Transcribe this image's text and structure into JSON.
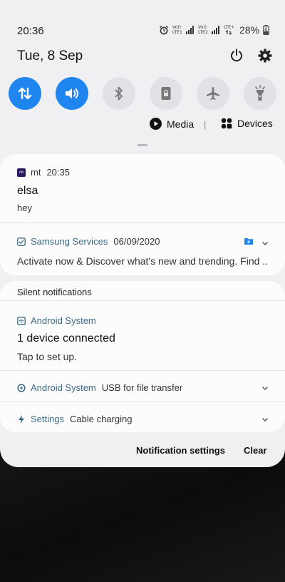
{
  "status_bar": {
    "time": "20:36",
    "sim1_label": "Vo)) LTE1",
    "sim2_label": "Vo)) LTE2",
    "sim2_tag": "LTE+",
    "battery": "28%"
  },
  "header": {
    "date": "Tue, 8 Sep"
  },
  "quick_toggles": [
    {
      "name": "mobile-data",
      "state": "on"
    },
    {
      "name": "sound",
      "state": "on"
    },
    {
      "name": "bluetooth",
      "state": "off"
    },
    {
      "name": "screen-lock",
      "state": "off"
    },
    {
      "name": "airplane-mode",
      "state": "off"
    },
    {
      "name": "flashlight",
      "state": "off"
    }
  ],
  "media_row": {
    "media_label": "Media",
    "separator": "|",
    "devices_label": "Devices"
  },
  "notifications": {
    "mt": {
      "app": "mt",
      "icon_text": "mt",
      "time": "20:35",
      "title": "elsa",
      "body": "hey"
    },
    "samsung": {
      "app": "Samsung Services",
      "date": "06/09/2020",
      "body": "Activate now & Discover what's new and trending. Find .."
    },
    "silent_header": "Silent notifications",
    "android_connected": {
      "app": "Android System",
      "title": "1 device connected",
      "body": "Tap to set up."
    },
    "android_usb": {
      "app": "Android System",
      "text": "USB for file transfer"
    },
    "settings_charging": {
      "app": "Settings",
      "text": "Cable charging"
    }
  },
  "footer": {
    "notification_settings": "Notification settings",
    "clear": "Clear"
  },
  "colors": {
    "accent": "#1f86f0",
    "app_name": "#3b6a86",
    "shade_bg": "#f0f0f3"
  }
}
